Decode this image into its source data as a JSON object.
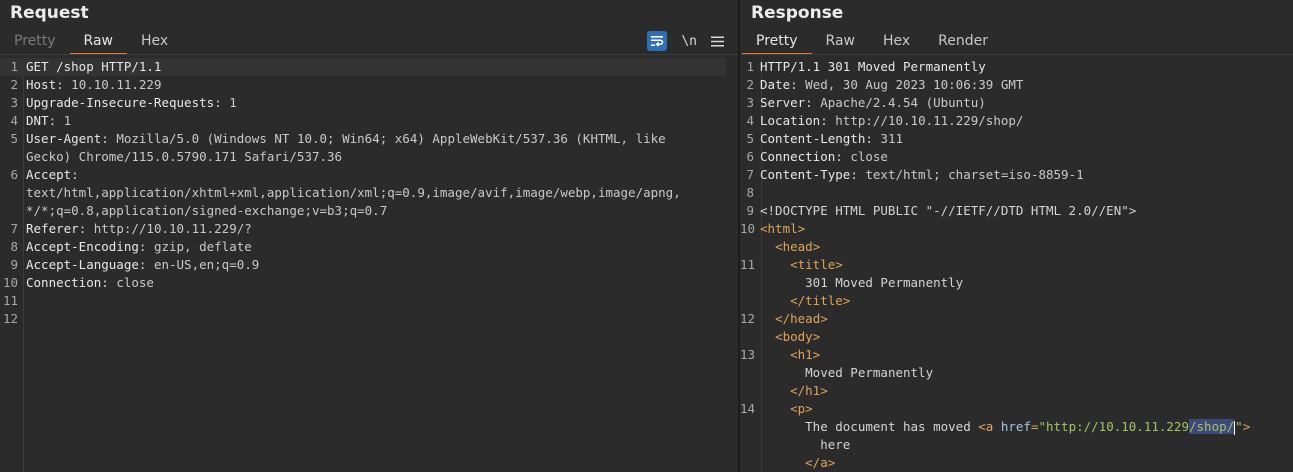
{
  "request": {
    "title": "Request",
    "tabs": [
      "Pretty",
      "Raw",
      "Hex"
    ],
    "active_tab": "Raw",
    "tools": {
      "wrap_icon": "word-wrap-icon",
      "newline_label": "\\n",
      "menu_icon": "hamburger-menu-icon"
    },
    "lines": [
      {
        "n": "1",
        "key": "",
        "value": "GET /shop HTTP/1.1"
      },
      {
        "n": "2",
        "key": "Host",
        "value": "10.10.11.229"
      },
      {
        "n": "3",
        "key": "Upgrade-Insecure-Requests",
        "value": "1"
      },
      {
        "n": "4",
        "key": "DNT",
        "value": "1"
      },
      {
        "n": "5",
        "key": "User-Agent",
        "value": "Mozilla/5.0 (Windows NT 10.0; Win64; x64) AppleWebKit/537.36 (KHTML, like",
        "cont": [
          "Gecko) Chrome/115.0.5790.171 Safari/537.36"
        ]
      },
      {
        "n": "6",
        "key": "Accept",
        "value": "",
        "cont": [
          "text/html,application/xhtml+xml,application/xml;q=0.9,image/avif,image/webp,image/apng,",
          "*/*;q=0.8,application/signed-exchange;v=b3;q=0.7"
        ]
      },
      {
        "n": "7",
        "key": "Referer",
        "value": "http://10.10.11.229/?"
      },
      {
        "n": "8",
        "key": "Accept-Encoding",
        "value": "gzip, deflate"
      },
      {
        "n": "9",
        "key": "Accept-Language",
        "value": "en-US,en;q=0.9"
      },
      {
        "n": "10",
        "key": "Connection",
        "value": "close"
      },
      {
        "n": "11",
        "key": "",
        "value": ""
      },
      {
        "n": "12",
        "key": "",
        "value": ""
      }
    ]
  },
  "response": {
    "title": "Response",
    "tabs": [
      "Pretty",
      "Raw",
      "Hex",
      "Render"
    ],
    "active_tab": "Pretty",
    "headers": [
      {
        "n": "1",
        "key": "",
        "value": "HTTP/1.1 301 Moved Permanently"
      },
      {
        "n": "2",
        "key": "Date",
        "value": "Wed, 30 Aug 2023 10:06:39 GMT"
      },
      {
        "n": "3",
        "key": "Server",
        "value": "Apache/2.4.54 (Ubuntu)"
      },
      {
        "n": "4",
        "key": "Location",
        "value": "http://10.10.11.229/shop/"
      },
      {
        "n": "5",
        "key": "Content-Length",
        "value": "311"
      },
      {
        "n": "6",
        "key": "Connection",
        "value": "close"
      },
      {
        "n": "7",
        "key": "Content-Type",
        "value": "text/html; charset=iso-8859-1"
      },
      {
        "n": "8",
        "key": "",
        "value": ""
      }
    ],
    "body": {
      "doctype": "<!DOCTYPE HTML PUBLIC \"-//IETF//DTD HTML 2.0//EN\">",
      "html_open": "<html>",
      "head_open": "<head>",
      "title_open": "<title>",
      "title_text": "301 Moved Permanently",
      "title_close": "</title>",
      "head_close": "</head>",
      "body_open": "<body>",
      "h1_open": "<h1>",
      "h1_text": "Moved Permanently",
      "h1_close": "</h1>",
      "p_open": "<p>",
      "p_text": "The document has moved ",
      "a_open_start": "<a ",
      "a_attr": "href",
      "a_eq": "=",
      "a_val_q1": "\"",
      "a_val_host": "http://10.10.11.229",
      "a_val_path": "/shop/",
      "a_val_q2": "\"",
      "a_open_end": ">",
      "a_text": "here",
      "a_close": "</a>",
      "line_numbers": [
        "9",
        "10",
        "",
        "11",
        "",
        "",
        "12",
        "",
        "13",
        "",
        "",
        "14",
        "",
        "",
        ""
      ]
    }
  }
}
